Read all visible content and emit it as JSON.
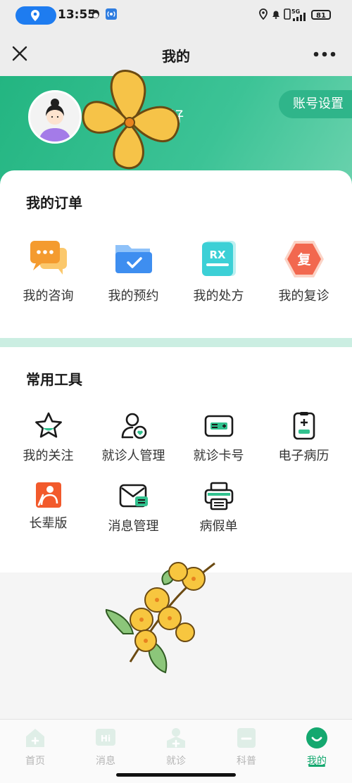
{
  "status_bar": {
    "time": "13:55",
    "network": "5G",
    "battery": "81"
  },
  "title_bar": {
    "title": "我的",
    "close_icon": "close-icon",
    "more_icon": "more-icon"
  },
  "header": {
    "greeting": "好",
    "account_settings": "账号设置"
  },
  "orders": {
    "title": "我的订单",
    "items": [
      {
        "label": "我的咨询",
        "icon": "chat-bubbles-icon"
      },
      {
        "label": "我的预约",
        "icon": "folder-check-icon"
      },
      {
        "label": "我的处方",
        "icon": "rx-icon",
        "icon_text": "RX"
      },
      {
        "label": "我的复诊",
        "icon": "revisit-hexagon-icon",
        "icon_text": "复"
      }
    ]
  },
  "tools": {
    "title": "常用工具",
    "items": [
      {
        "label": "我的关注",
        "icon": "star-icon"
      },
      {
        "label": "就诊人管理",
        "icon": "patient-manage-icon"
      },
      {
        "label": "就诊卡号",
        "icon": "medical-card-icon"
      },
      {
        "label": "电子病历",
        "icon": "medical-record-icon"
      },
      {
        "label": "长辈版",
        "icon": "elder-mode-icon"
      },
      {
        "label": "消息管理",
        "icon": "message-manage-icon"
      },
      {
        "label": "病假单",
        "icon": "printer-icon"
      }
    ]
  },
  "tabs": [
    {
      "label": "首页",
      "icon": "home-icon"
    },
    {
      "label": "消息",
      "icon": "message-icon",
      "icon_text": "Hi"
    },
    {
      "label": "就诊",
      "icon": "visit-icon"
    },
    {
      "label": "科普",
      "icon": "science-icon"
    },
    {
      "label": "我的",
      "icon": "profile-icon",
      "active": true
    }
  ],
  "colors": {
    "brand_green": "#23b581",
    "tab_active": "#14a86f",
    "orders_orange": "#f6a63a",
    "folder_blue": "#3e8ef0",
    "rx_cyan": "#3cd0d6",
    "revisit_red": "#f2684f"
  }
}
